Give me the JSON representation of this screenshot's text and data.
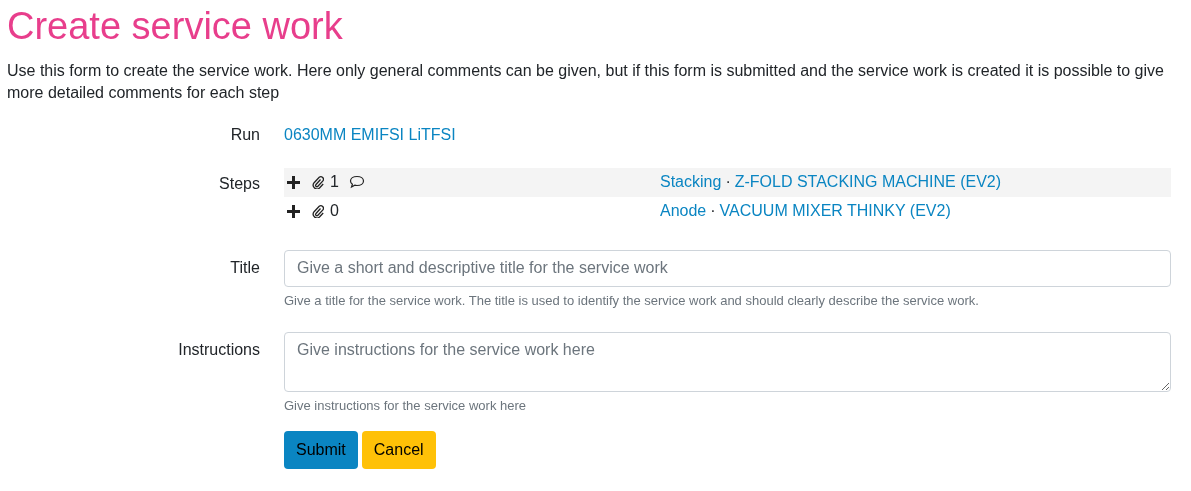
{
  "page_title": "Create service work",
  "intro": "Use this form to create the service work. Here only general comments can be given, but if this form is submitted and the service work is created it is possible to give more detailed comments for each step",
  "run": {
    "label": "Run",
    "value": "0630MM EMIFSI LiTFSI"
  },
  "steps": {
    "label": "Steps",
    "items": [
      {
        "attachments": "1",
        "has_comment": true,
        "step": "Stacking",
        "separator": "·",
        "machine": "Z-FOLD STACKING MACHINE (EV2)"
      },
      {
        "attachments": "0",
        "has_comment": false,
        "step": "Anode",
        "separator": "·",
        "machine": "VACUUM MIXER THINKY (EV2)"
      }
    ]
  },
  "title_field": {
    "label": "Title",
    "placeholder": "Give a short and descriptive title for the service work",
    "help": "Give a title for the service work. The title is used to identify the service work and should clearly describe the service work."
  },
  "instructions_field": {
    "label": "Instructions",
    "placeholder": "Give instructions for the service work here",
    "help": "Give instructions for the service work here"
  },
  "buttons": [
    {
      "label": "Submit",
      "kind": "primary"
    },
    {
      "label": "Cancel",
      "kind": "warning"
    }
  ]
}
